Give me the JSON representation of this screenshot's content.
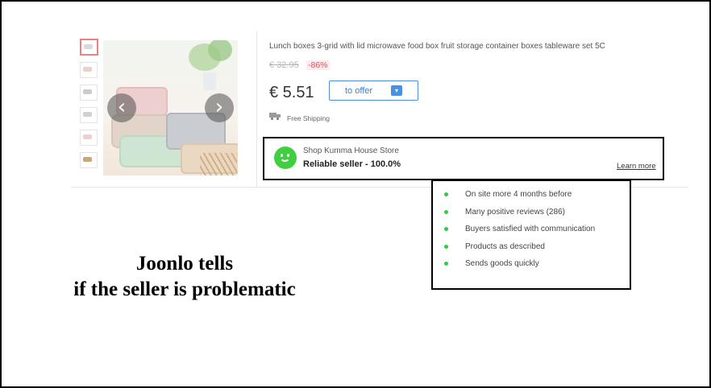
{
  "product": {
    "title": "Lunch boxes 3-grid with lid microwave food box fruit storage container boxes tableware set 5C",
    "old_price": "€ 32.95",
    "discount": "-86%",
    "price": "€ 5.51",
    "offer_button_label": "to offer",
    "offer_icon": "cart-icon",
    "shipping_label": "Free Shipping",
    "thumbnail_colors": [
      "#d9d9d9",
      "#eecfd0",
      "#c9ccd0",
      "#cfd3cf",
      "#eecfd0",
      "#c9a777"
    ],
    "prev_arrow": "‹",
    "next_arrow": "›"
  },
  "seller": {
    "shop_name": "Shop Kumma House Store",
    "rating_text": "Reliable seller - 100.0%",
    "learn_more": "Learn more",
    "status_color": "#3fcf3f"
  },
  "reasons": [
    "On site more 4 months before",
    "Many positive reviews (286)",
    "Buyers satisfied with communication",
    "Products as described",
    "Sends goods quickly"
  ],
  "caption": {
    "line1": "Joonlo tells",
    "line2": "if the seller is problematic"
  }
}
